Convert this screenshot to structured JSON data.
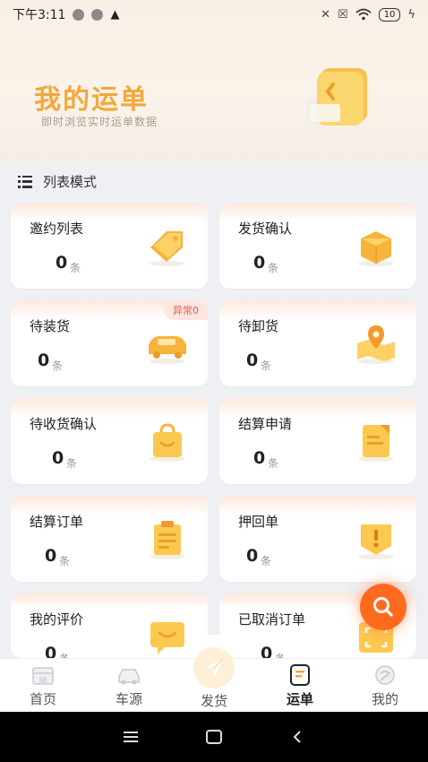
{
  "status_bar": {
    "time": "下午3:11",
    "battery": "10"
  },
  "header": {
    "title": "我的运单",
    "subtitle": "即时浏览实时运单数据"
  },
  "list_mode": {
    "label": "列表模式"
  },
  "unit": "条",
  "cards": [
    {
      "title": "邀约列表",
      "count": "0",
      "icon": "tag-icon"
    },
    {
      "title": "发货确认",
      "count": "0",
      "icon": "package-box-icon"
    },
    {
      "title": "待装货",
      "count": "0",
      "icon": "truck-icon",
      "badge": "异常0"
    },
    {
      "title": "待卸货",
      "count": "0",
      "icon": "map-pin-icon"
    },
    {
      "title": "待收货确认",
      "count": "0",
      "icon": "shopping-bag-icon"
    },
    {
      "title": "结算申请",
      "count": "0",
      "icon": "document-icon"
    },
    {
      "title": "结算订单",
      "count": "0",
      "icon": "clipboard-icon"
    },
    {
      "title": "押回单",
      "count": "0",
      "icon": "alert-shield-icon"
    },
    {
      "title": "我的评价",
      "count": "0",
      "icon": "chat-bubble-icon"
    },
    {
      "title": "已取消订单",
      "count": "0",
      "icon": "scan-icon"
    }
  ],
  "tabs": [
    {
      "label": "首页",
      "icon": "home-icon"
    },
    {
      "label": "车源",
      "icon": "car-icon"
    },
    {
      "label": "发货",
      "icon": "send-icon"
    },
    {
      "label": "运单",
      "icon": "waybill-icon",
      "active": true
    },
    {
      "label": "我的",
      "icon": "profile-icon"
    }
  ],
  "colors": {
    "accent": "#f3a83a",
    "fab": "#ff6a1f",
    "badge_text": "#e85b4e"
  }
}
